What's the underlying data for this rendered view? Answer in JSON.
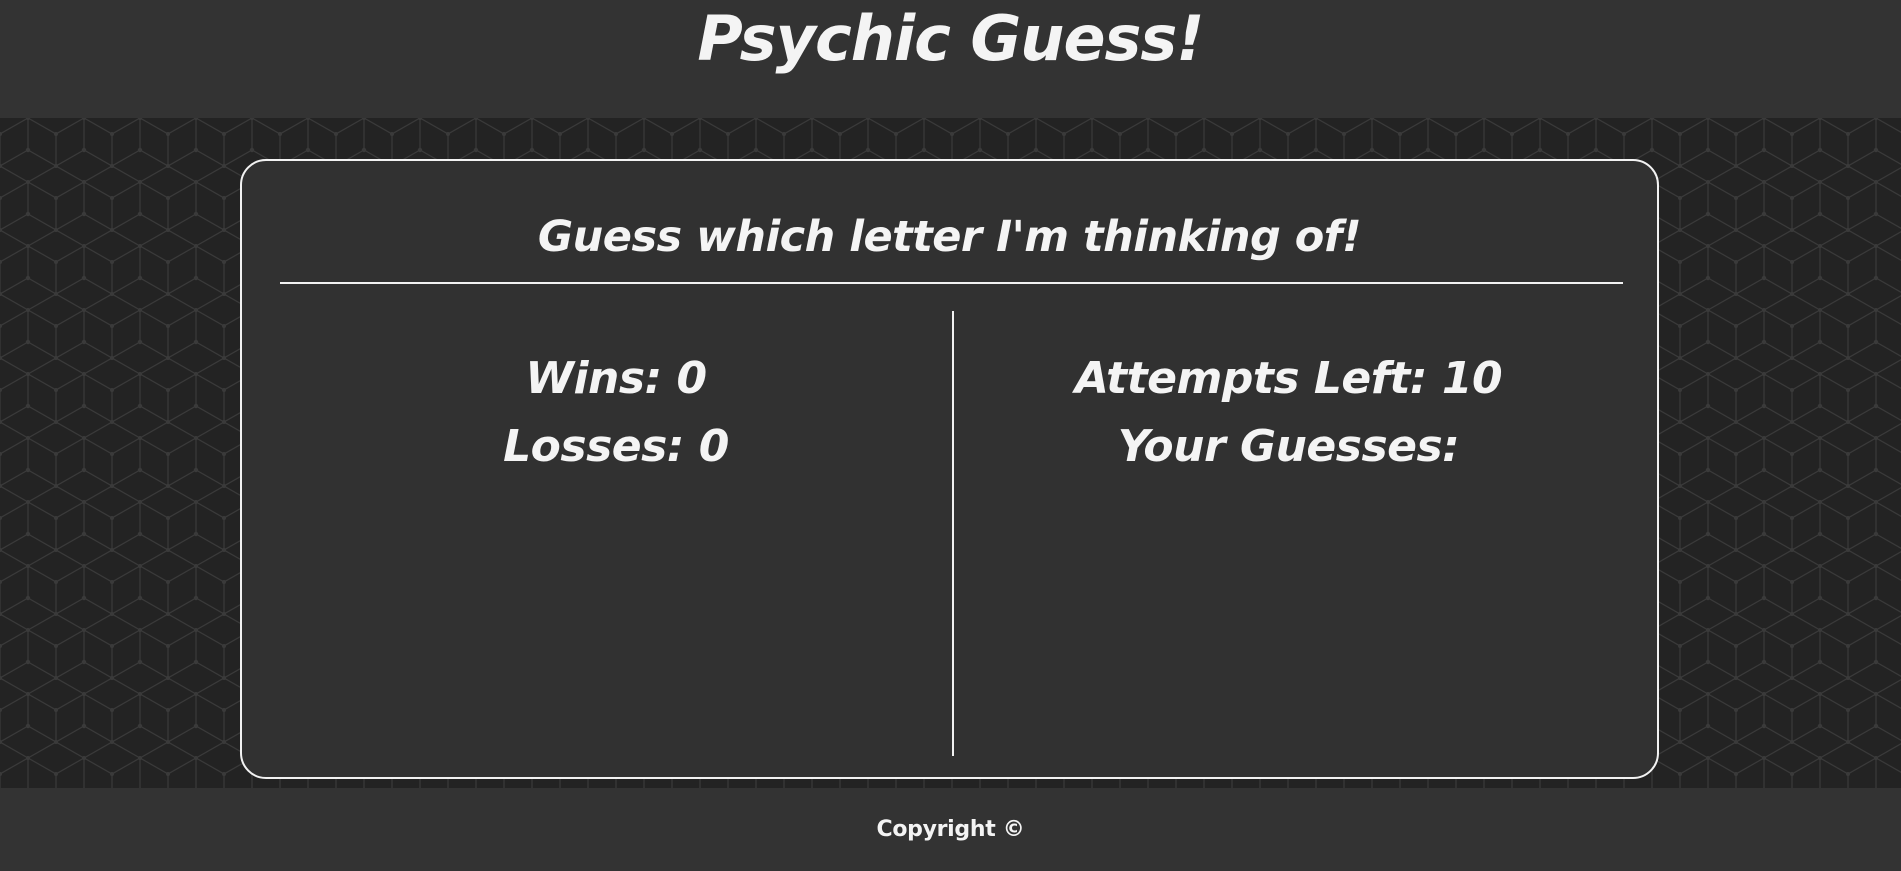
{
  "header": {
    "title": "Psychic Guess!"
  },
  "game": {
    "prompt": "Guess which letter I'm thinking of!",
    "wins_label": "Wins:",
    "wins_value": "0",
    "losses_label": "Losses:",
    "losses_value": "0",
    "attempts_label": "Attempts Left:",
    "attempts_value": "10",
    "guesses_label": "Your Guesses:",
    "guesses_value": ""
  },
  "footer": {
    "copyright": "Copyright ©"
  },
  "colors": {
    "background_pattern": "#232323",
    "panel": "#313131",
    "header_footer": "#333333",
    "text_and_border": "#f2f2f2"
  }
}
